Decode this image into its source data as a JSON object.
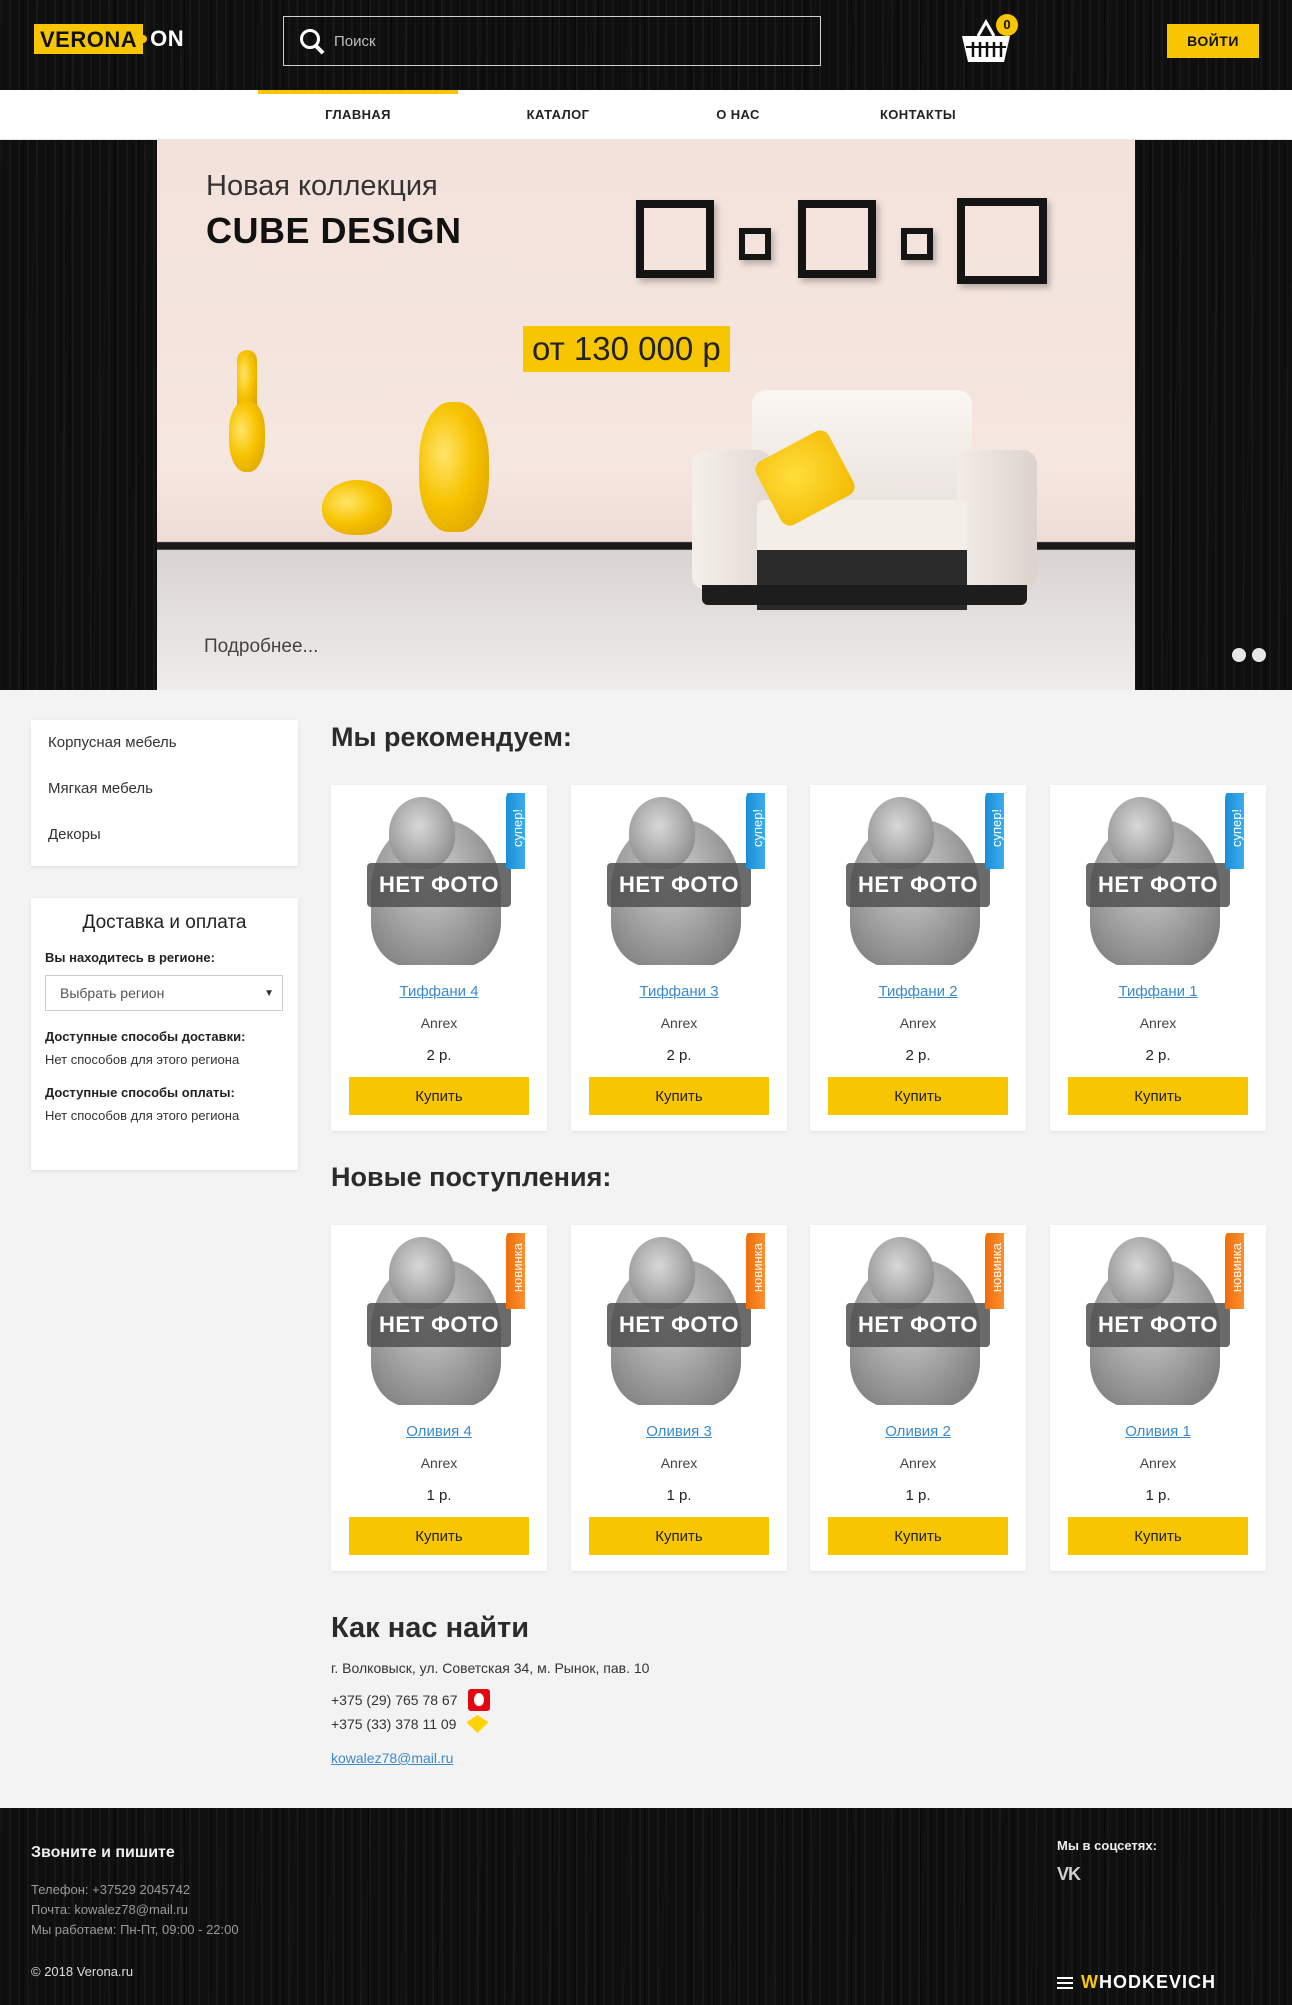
{
  "header": {
    "logo_main": "VERONA",
    "logo_suffix": "ON",
    "search_placeholder": "Поиск",
    "cart_count": "0",
    "login_label": "ВОЙТИ"
  },
  "nav": {
    "items": [
      {
        "label": "ГЛАВНАЯ",
        "active": true
      },
      {
        "label": "КАТАЛОГ",
        "active": false
      },
      {
        "label": "О НАС",
        "active": false
      },
      {
        "label": "КОНТАКТЫ",
        "active": false
      }
    ]
  },
  "hero": {
    "subtitle": "Новая коллекция",
    "title": "CUBE DESIGN",
    "price": "от 130 000 р",
    "more": "Подробнее...",
    "slides_count": 2
  },
  "sidebar": {
    "categories": [
      "Корпусная мебель",
      "Мягкая мебель",
      "Декоры"
    ],
    "delivery": {
      "title": "Доставка и оплата",
      "region_label": "Вы находитесь в регионе:",
      "region_select": "Выбрать регион",
      "delivery_label": "Доступные способы доставки:",
      "delivery_value": "Нет способов для этого региона",
      "payment_label": "Доступные способы оплаты:",
      "payment_value": "Нет способов для этого региона"
    }
  },
  "recommended": {
    "title": "Мы рекомендуем:",
    "products": [
      {
        "name": "Тиффани 4",
        "brand": "Anrex",
        "price": "2 р.",
        "badge": "супер!",
        "photo": "НЕТ ФОТО",
        "buy": "Купить"
      },
      {
        "name": "Тиффани 3",
        "brand": "Anrex",
        "price": "2 р.",
        "badge": "супер!",
        "photo": "НЕТ ФОТО",
        "buy": "Купить"
      },
      {
        "name": "Тиффани 2",
        "brand": "Anrex",
        "price": "2 р.",
        "badge": "супер!",
        "photo": "НЕТ ФОТО",
        "buy": "Купить"
      },
      {
        "name": "Тиффани 1",
        "brand": "Anrex",
        "price": "2 р.",
        "badge": "супер!",
        "photo": "НЕТ ФОТО",
        "buy": "Купить"
      }
    ]
  },
  "new_arrivals": {
    "title": "Новые поступления:",
    "products": [
      {
        "name": "Оливия 4",
        "brand": "Anrex",
        "price": "1 р.",
        "badge": "новинка",
        "photo": "НЕТ ФОТО",
        "buy": "Купить"
      },
      {
        "name": "Оливия 3",
        "brand": "Anrex",
        "price": "1 р.",
        "badge": "новинка",
        "photo": "НЕТ ФОТО",
        "buy": "Купить"
      },
      {
        "name": "Оливия 2",
        "brand": "Anrex",
        "price": "1 р.",
        "badge": "новинка",
        "photo": "НЕТ ФОТО",
        "buy": "Купить"
      },
      {
        "name": "Оливия 1",
        "brand": "Anrex",
        "price": "1 р.",
        "badge": "новинка",
        "photo": "НЕТ ФОТО",
        "buy": "Купить"
      }
    ]
  },
  "contacts": {
    "title": "Как нас найти",
    "address": "г. Волковыск, ул. Советская 34, м. Рынок, пав. 10",
    "phone_mts": "+375 (29) 765 78 67",
    "phone_life": "+375 (33) 378 11 09",
    "email": "kowalez78@mail.ru"
  },
  "footer": {
    "title": "Звоните и пишите",
    "phone": "Телефон: +37529 2045742",
    "mail": "Почта: kowalez78@mail.ru",
    "hours": "Мы работаем: Пн-Пт, 09:00 - 22:00",
    "copyright": "© 2018 Verona.ru",
    "social_title": "Мы в соцсетях:",
    "social_vk": "VK",
    "developer_first": "W",
    "developer_rest": "HODKEVICH"
  },
  "colors": {
    "accent": "#f8c600",
    "link": "#3c8ac8",
    "dark_bg": "#0f0f0f"
  }
}
